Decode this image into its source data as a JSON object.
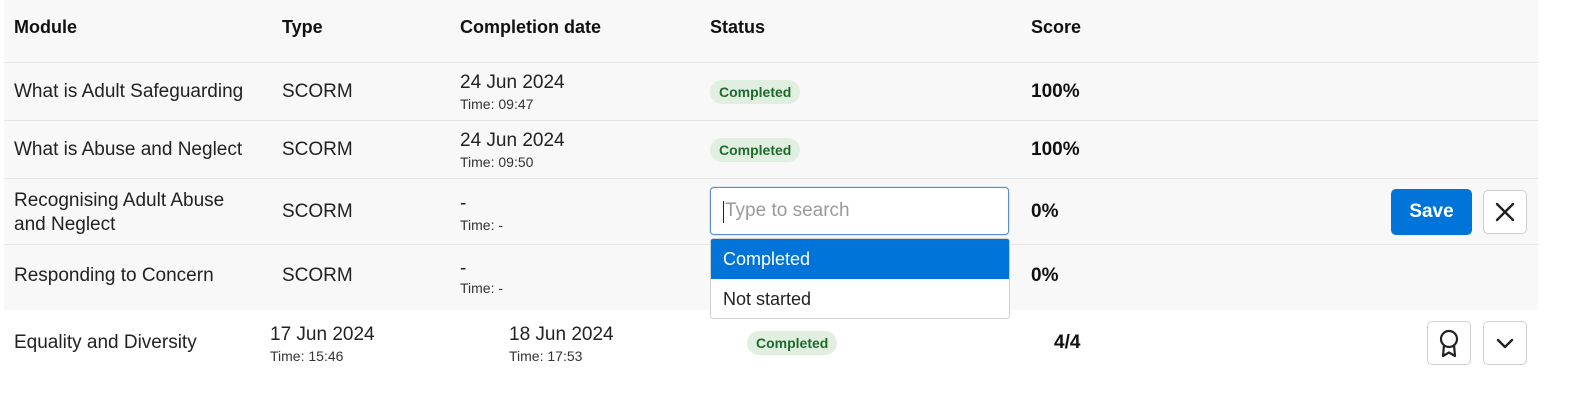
{
  "headers": {
    "module": "Module",
    "type": "Type",
    "completion_date": "Completion date",
    "status": "Status",
    "score": "Score"
  },
  "rows": [
    {
      "module": "What is Adult Safeguarding",
      "type": "SCORM",
      "date": "24 Jun 2024",
      "time": "Time: 09:47",
      "status": "Completed",
      "score": "100%"
    },
    {
      "module": "What is Abuse and Neglect",
      "type": "SCORM",
      "date": "24 Jun 2024",
      "time": "Time: 09:50",
      "status": "Completed",
      "score": "100%"
    },
    {
      "module_line1": "Recognising Adult Abuse",
      "module_line2": "and Neglect",
      "type": "SCORM",
      "date": "-",
      "time": "Time: -",
      "score": "0%"
    },
    {
      "module": "Responding to Concern",
      "type": "SCORM",
      "date": "-",
      "time": "Time: -",
      "score": "0%"
    }
  ],
  "status_editor": {
    "placeholder": "Type to search",
    "value": "",
    "options": [
      "Completed",
      "Not started"
    ],
    "selected": "Completed",
    "save_label": "Save"
  },
  "course": {
    "module": "Equality and Diversity",
    "start_date": "17 Jun 2024",
    "start_time": "Time: 15:46",
    "end_date": "18 Jun 2024",
    "end_time": "Time: 17:53",
    "status": "Completed",
    "score": "4/4"
  },
  "icons": {
    "cancel": "close-icon",
    "certificate": "award-icon",
    "expand": "chevron-down-icon"
  },
  "colors": {
    "accent": "#0074d9",
    "badge_bg": "#e1efe1",
    "badge_text": "#1e6b2e"
  }
}
